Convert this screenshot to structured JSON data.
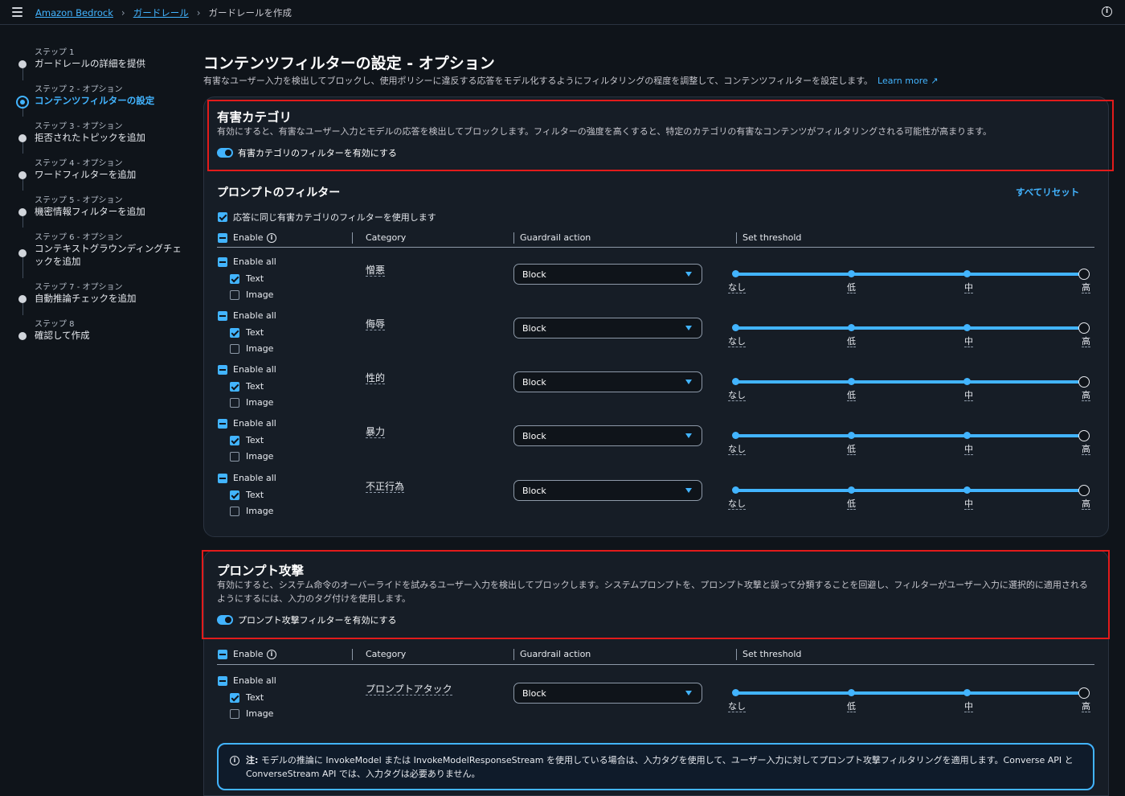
{
  "breadcrumb": {
    "items": [
      "Amazon Bedrock",
      "ガードレール"
    ],
    "current": "ガードレールを作成"
  },
  "steps": [
    {
      "sub": "ステップ 1",
      "title": "ガードレールの詳細を提供"
    },
    {
      "sub": "ステップ 2 - オプション",
      "title": "コンテンツフィルターの設定"
    },
    {
      "sub": "ステップ 3 - オプション",
      "title": "拒否されたトピックを追加"
    },
    {
      "sub": "ステップ 4 - オプション",
      "title": "ワードフィルターを追加"
    },
    {
      "sub": "ステップ 5 - オプション",
      "title": "機密情報フィルターを追加"
    },
    {
      "sub": "ステップ 6 - オプション",
      "title": "コンテキストグラウンディングチェックを追加"
    },
    {
      "sub": "ステップ 7 - オプション",
      "title": "自動推論チェックを追加"
    },
    {
      "sub": "ステップ 8",
      "title": "確認して作成"
    }
  ],
  "page": {
    "title": "コンテンツフィルターの設定 - オプション",
    "description": "有害なユーザー入力を検出してブロックし、使用ポリシーに違反する応答をモデル化するようにフィルタリングの程度を調整して、コンテンツフィルターを設定します。",
    "learn_more": "Learn more"
  },
  "harmful": {
    "title": "有害カテゴリ",
    "description": "有効にすると、有害なユーザー入力とモデルの応答を検出してブロックします。フィルターの強度を高くすると、特定のカテゴリの有害なコンテンツがフィルタリングされる可能性が高まります。",
    "toggle_label": "有害カテゴリのフィルターを有効にする",
    "prompt_filters_title": "プロンプトのフィルター",
    "reset_all": "すべてリセット",
    "same_filters_label": "応答に同じ有害カテゴリのフィルターを使用します"
  },
  "table_header": {
    "enable": "Enable",
    "category": "Category",
    "action": "Guardrail action",
    "threshold": "Set threshold"
  },
  "row_labels": {
    "enable_all": "Enable all",
    "text": "Text",
    "image": "Image"
  },
  "categories": [
    {
      "name": "憎悪",
      "action": "Block"
    },
    {
      "name": "侮辱",
      "action": "Block"
    },
    {
      "name": "性的",
      "action": "Block"
    },
    {
      "name": "暴力",
      "action": "Block"
    },
    {
      "name": "不正行為",
      "action": "Block"
    }
  ],
  "threshold_labels": [
    "なし",
    "低",
    "中",
    "高"
  ],
  "threshold_value": "高",
  "prompt_attack": {
    "title": "プロンプト攻撃",
    "description": "有効にすると、システム命令のオーバーライドを試みるユーザー入力を検出してブロックします。システムプロンプトを、プロンプト攻撃と誤って分類することを回避し、フィルターがユーザー入力に選択的に適用されるようにするには、入力のタグ付けを使用します。",
    "toggle_label": "プロンプト攻撃フィルターを有効にする",
    "category": {
      "name": "プロンプトアタック",
      "action": "Block"
    }
  },
  "note": {
    "prefix": "注:",
    "text": " モデルの推論に InvokeModel または InvokeModelResponseStream を使用している場合は、入力タグを使用して、ユーザー入力に対してプロンプト攻撃フィルタリングを適用します。Converse API と ConverseStream API では、入力タグは必要ありません。"
  },
  "colors": {
    "accent": "#42b4ff",
    "highlight": "#e21b1b",
    "background": "#0f141a"
  }
}
